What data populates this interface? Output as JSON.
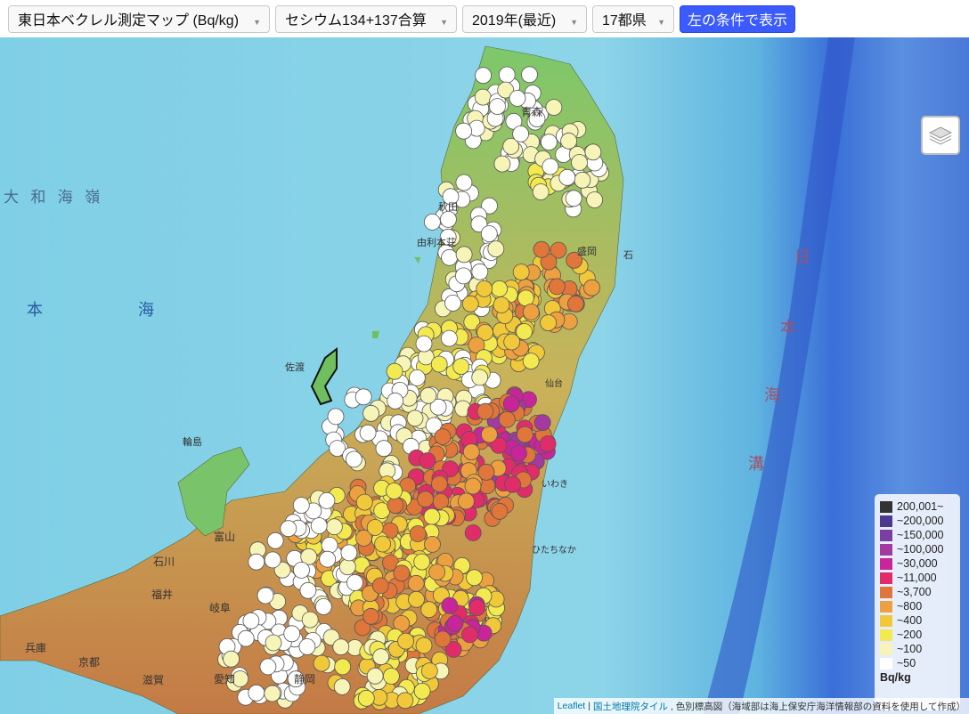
{
  "toolbar": {
    "map_select": "東日本ベクレル測定マップ (Bq/kg)",
    "nuclide_select": "セシウム134+137合算",
    "year_select": "2019年(最近)",
    "region_select": "17都県",
    "show_button": "左の条件で表示"
  },
  "map": {
    "sea_labels": [
      {
        "text": "大 和 海 嶺"
      },
      {
        "text": "本"
      },
      {
        "text": "海"
      },
      {
        "text": "日"
      },
      {
        "text": "本"
      },
      {
        "text": "海"
      },
      {
        "text": "溝"
      }
    ],
    "place_labels": [
      "青森",
      "秋田",
      "由利本荘",
      "盛岡",
      "石",
      "佐渡",
      "輪島",
      "富山",
      "石川",
      "福井",
      "岐阜",
      "兵庫",
      "京都",
      "滋賀",
      "愛知",
      "静岡",
      "いわき",
      "ひたちなか",
      "仙台"
    ],
    "colors": {
      "sea": "#6fc3df",
      "deep_sea": "#3a6fd8",
      "land_low": "#5cb85c",
      "land_high": "#c8864a"
    }
  },
  "legend": {
    "items": [
      {
        "label": "200,001~",
        "color": "#333333"
      },
      {
        "label": "~200,000",
        "color": "#4b3a8f"
      },
      {
        "label": "~150,000",
        "color": "#7a3fa0"
      },
      {
        "label": "~100,000",
        "color": "#a23aa0"
      },
      {
        "label": "~30,000",
        "color": "#c8259a"
      },
      {
        "label": "~11,000",
        "color": "#e02d6a"
      },
      {
        "label": "~3,700",
        "color": "#e0763a"
      },
      {
        "label": "~800",
        "color": "#eda040"
      },
      {
        "label": "~400",
        "color": "#f0c83a"
      },
      {
        "label": "~200",
        "color": "#f2ea50"
      },
      {
        "label": "~100",
        "color": "#f7f4b8"
      },
      {
        "label": "~50",
        "color": "#ffffff"
      }
    ],
    "unit": "Bq/kg"
  },
  "attribution": {
    "leaflet": "Leaflet",
    "tiles": "国土地理院タイル",
    "rest": ", 色別標高図（海域部は海上保安庁海洋情報部の資料を使用して作成）"
  }
}
